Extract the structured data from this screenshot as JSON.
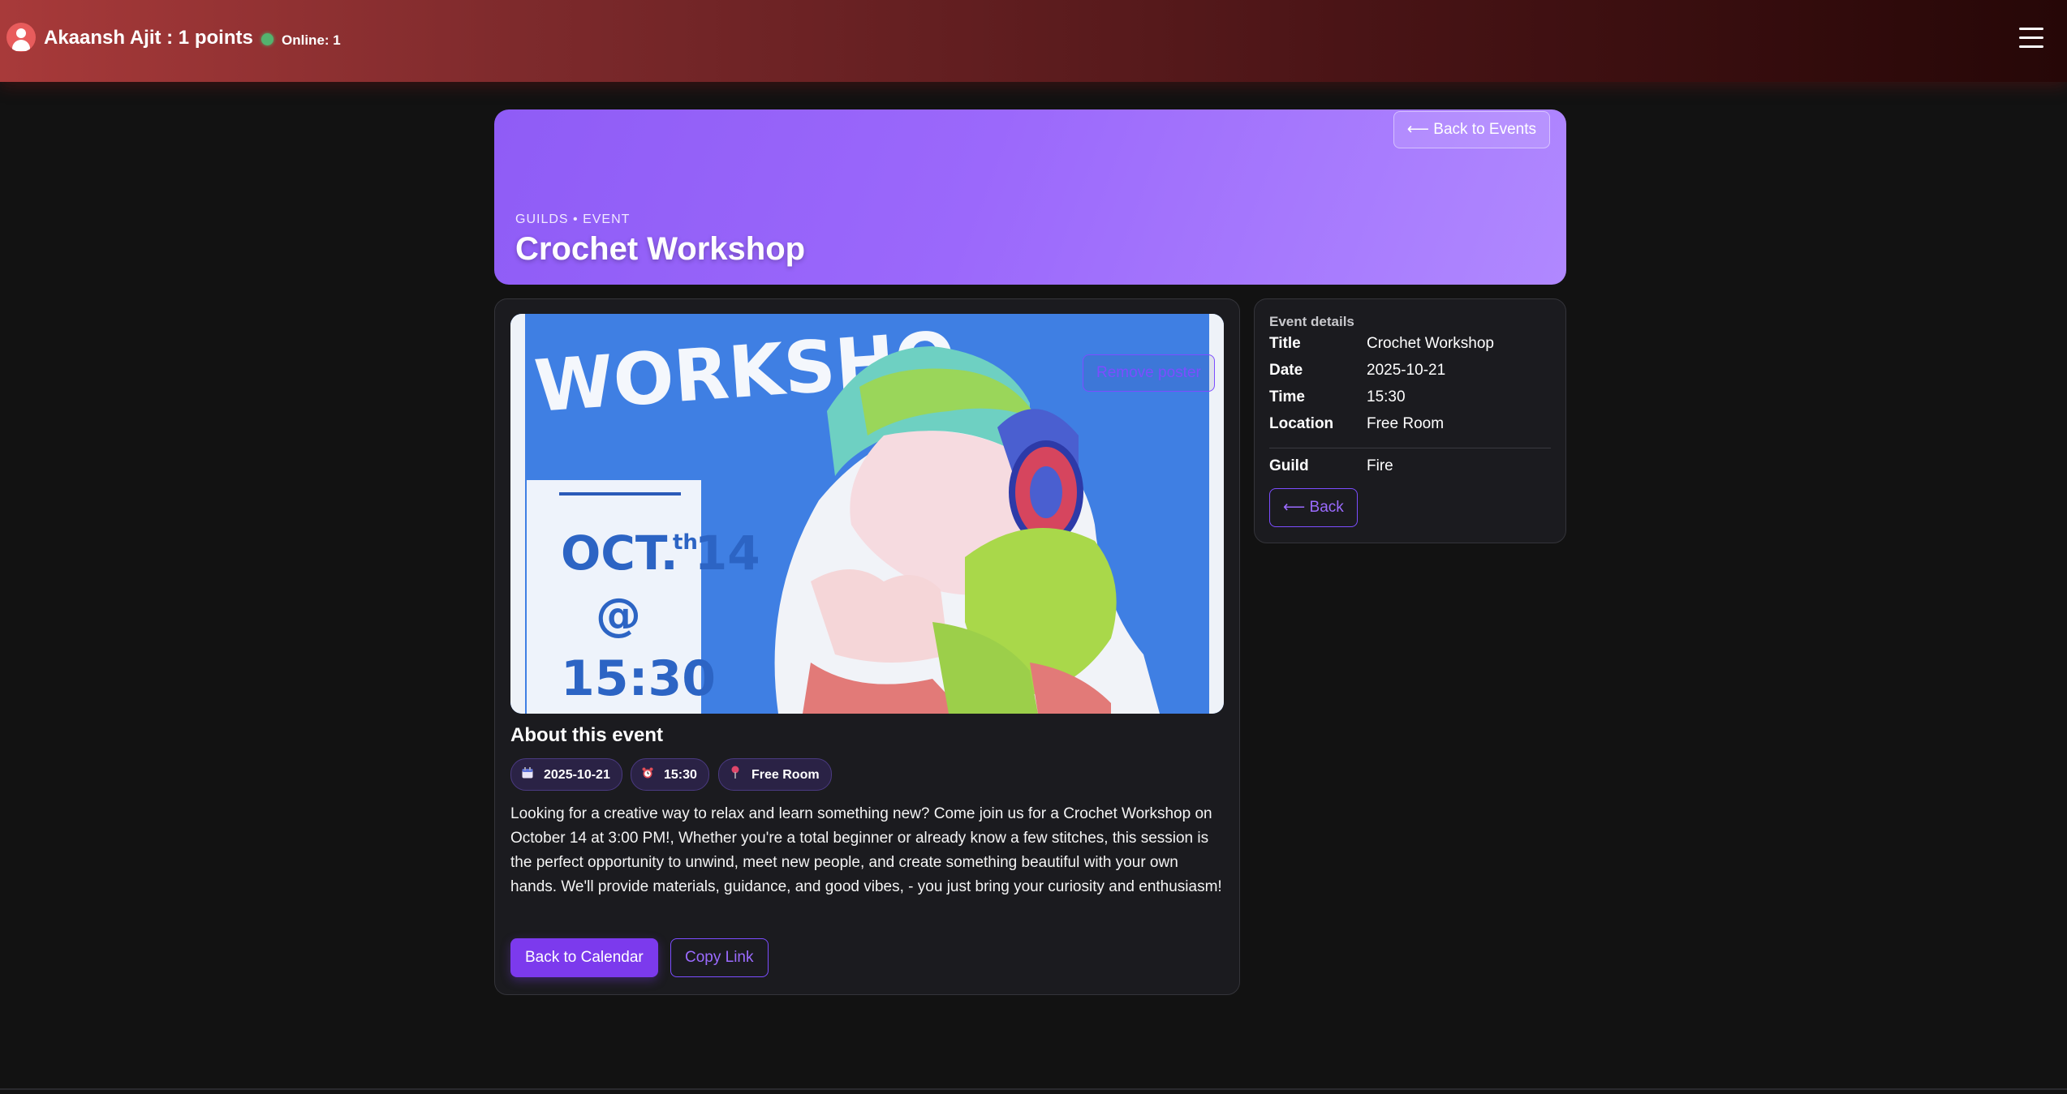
{
  "header": {
    "user_label": "Akaansh Ajit : 1 points",
    "online_label": "Online: 1",
    "icons": {
      "avatar": "user-avatar-icon",
      "menu": "hamburger-menu-icon",
      "status": "online-dot"
    }
  },
  "hero": {
    "back_label": "⟵ Back to Events",
    "crumb": "GUILDS • EVENT",
    "title": "Crochet Workshop"
  },
  "poster": {
    "remove_label": "Remove poster",
    "art_text": {
      "top": "WORKSHO",
      "date": "OCT. 14",
      "sup": "th",
      "at": "@",
      "time": "15:30"
    }
  },
  "about": {
    "heading": "About this event",
    "chips": [
      {
        "icon": "calendar-icon",
        "label": "2025-10-21"
      },
      {
        "icon": "alarm-clock-icon",
        "label": "15:30"
      },
      {
        "icon": "pin-icon",
        "label": "Free Room"
      }
    ],
    "description": "Looking for a creative way to relax and learn something new? Come join us for a Crochet Workshop on October 14 at 3:00 PM!, Whether you're a total beginner or already know a few stitches, this session is the perfect opportunity to unwind, meet new people, and create something beautiful with your own hands. We'll provide materials, guidance, and good vibes, - you just bring your curiosity and enthusiasm!",
    "calendar_button": "Back to Calendar",
    "copy_button": "Copy Link"
  },
  "details": {
    "heading": "Event details",
    "rows": [
      {
        "key": "Title",
        "value": "Crochet Workshop"
      },
      {
        "key": "Date",
        "value": "2025-10-21"
      },
      {
        "key": "Time",
        "value": "15:30"
      },
      {
        "key": "Location",
        "value": "Free Room"
      },
      {
        "key": "Guild",
        "value": "Fire"
      }
    ],
    "back_button": "⟵ Back"
  },
  "colors": {
    "accent": "#7c3aed",
    "hero": "#9b68fb",
    "header": "#7e2a2c",
    "background": "#121212"
  }
}
